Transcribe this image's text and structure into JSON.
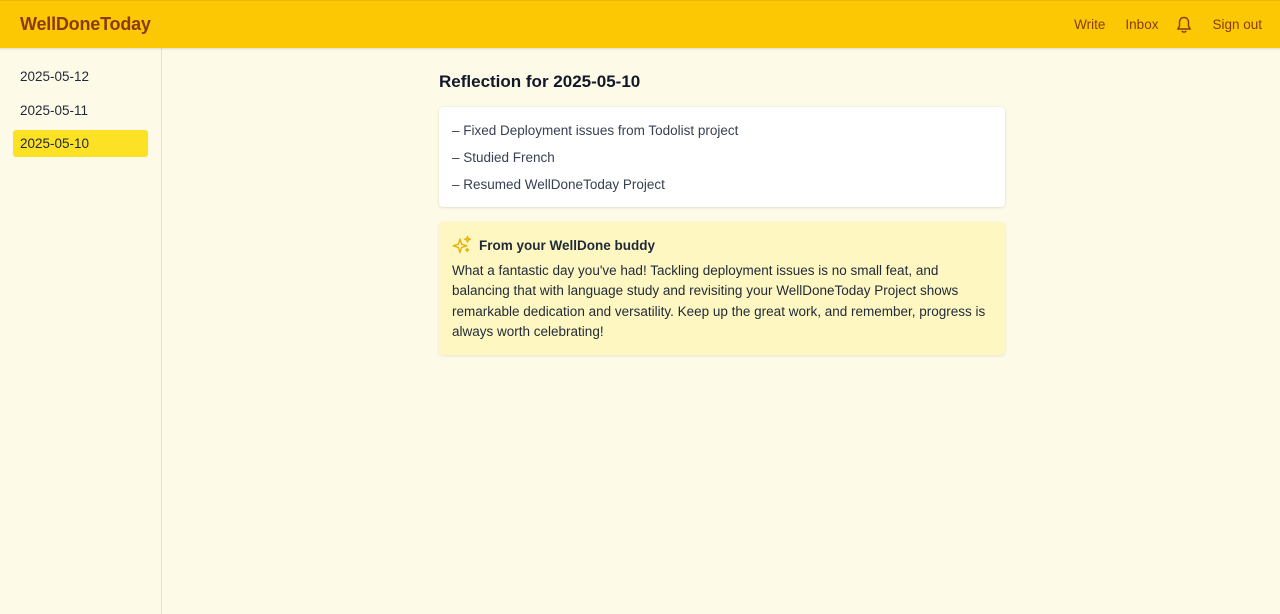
{
  "app": {
    "brand": "WellDoneToday"
  },
  "nav": {
    "write": "Write",
    "inbox": "Inbox",
    "sign_out": "Sign out"
  },
  "sidebar": {
    "items": [
      {
        "label": "2025-05-12",
        "active": false
      },
      {
        "label": "2025-05-11",
        "active": false
      },
      {
        "label": "2025-05-10",
        "active": true
      }
    ]
  },
  "main": {
    "title": "Reflection for 2025-05-10",
    "entries": [
      "– Fixed Deployment issues from Todolist project",
      "– Studied French",
      "– Resumed WellDoneToday Project"
    ],
    "buddy": {
      "icon": "sparkle-icon",
      "title": "From your WellDone buddy",
      "message": "What a fantastic day you've had! Tackling deployment issues is no small feat, and balancing that with language study and revisiting your WellDoneToday Project shows remarkable dedication and versatility. Keep up the great work, and remember, progress is always worth celebrating!"
    }
  },
  "colors": {
    "header": "#fcc804",
    "brand_text": "#8a3a0b",
    "background": "#fefae8",
    "active_item": "#fde125",
    "buddy_card": "#fef7c2",
    "sparkle": "#e6b10b"
  }
}
